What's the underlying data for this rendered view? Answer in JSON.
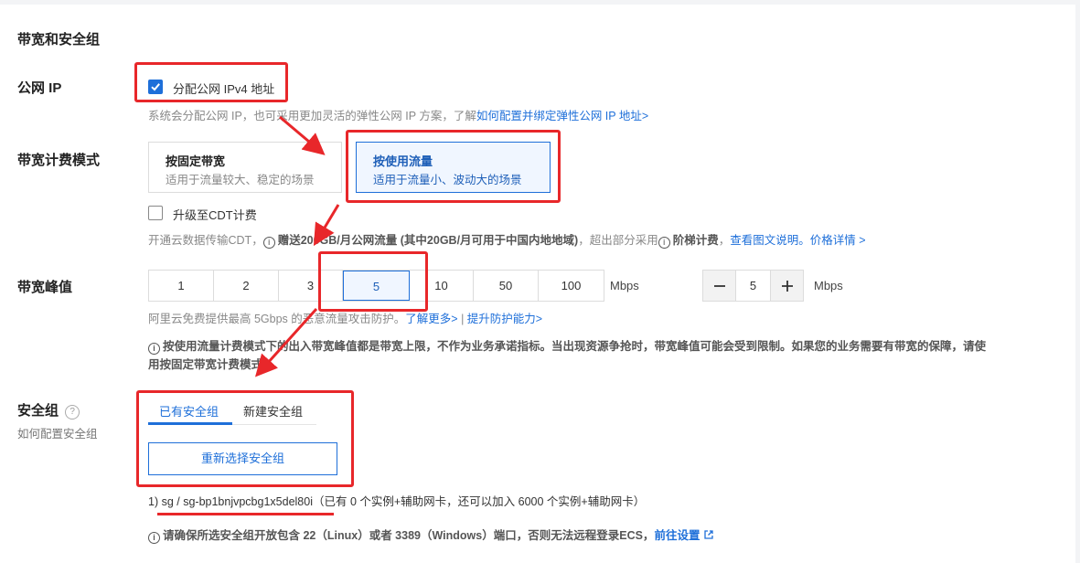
{
  "section_title": "带宽和安全组",
  "public_ip": {
    "label": "公网 IP",
    "checkbox_label": "分配公网 IPv4 地址",
    "checked": true,
    "hint": "系统会分配公网 IP，也可采用更加灵活的弹性公网 IP 方案，了解",
    "hint_link": "如何配置并绑定弹性公网 IP 地址>"
  },
  "billing": {
    "label": "带宽计费模式",
    "options": [
      {
        "title": "按固定带宽",
        "desc": "适用于流量较大、稳定的场景",
        "selected": false
      },
      {
        "title": "按使用流量",
        "desc": "适用于流量小、波动大的场景",
        "selected": true
      }
    ],
    "cdt_checkbox_label": "升级至CDT计费",
    "cdt_checked": false,
    "cdt_hint_prefix": "开通云数据传输CDT，",
    "cdt_hint_bold": "赠送200GB/月公网流量 (其中20GB/月可用于中国内地地域)",
    "cdt_hint_mid": "，超出部分采用",
    "cdt_hint_bold2": "阶梯计费",
    "cdt_hint_sep": "，",
    "cdt_link1": "查看图文说明。",
    "cdt_link2": "价格详情 >"
  },
  "bandwidth": {
    "label": "带宽峰值",
    "options": [
      "1",
      "2",
      "3",
      "5",
      "10",
      "50",
      "100"
    ],
    "selected": "5",
    "unit": "Mbps",
    "stepper_value": "5",
    "stepper_unit": "Mbps",
    "ddos_hint": "阿里云免费提供最高 5Gbps 的恶意流量攻击防护。",
    "ddos_link1": "了解更多>",
    "ddos_sep": " | ",
    "ddos_link2": "提升防护能力>",
    "note_line1": "按使用流量计费模式下的出入带宽峰值都是带宽上限，不作为业务承诺指标。当出现资源争抢时，带宽峰值可能会受到限制。如果您的业务需要有带宽的保障，请使",
    "note_line2": "用按固定带宽计费模式"
  },
  "security_group": {
    "label": "安全组",
    "help_glyph": "?",
    "sub_label": "如何配置安全组",
    "tabs": [
      "已有安全组",
      "新建安全组"
    ],
    "active_tab": 0,
    "reselect_button": "重新选择安全组",
    "selected_group": "1) sg / sg-bp1bnjvpcbg1x5del80i（已有 0 个实例+辅助网卡，还可以加入 6000 个实例+辅助网卡）",
    "port_note": "请确保所选安全组开放包含 22（Linux）或者 3389（Windows）端口，否则无法远程登录ECS，",
    "port_link": "前往设置"
  },
  "accent_color": "#1e6fd9",
  "annotation_color": "#e8272a"
}
